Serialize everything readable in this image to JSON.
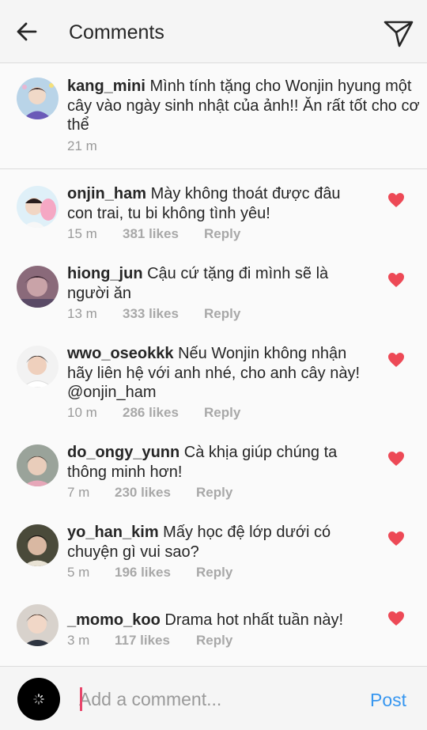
{
  "header": {
    "title": "Comments",
    "back_icon": "arrow-left-icon",
    "send_icon": "paper-plane-icon"
  },
  "caption": {
    "username": "kang_mini",
    "text": "Mình tính tặng cho Wonjin hyung một cây vào ngày sinh nhật của ảnh!! Ăn rất tốt cho cơ thể",
    "time": "21 m"
  },
  "comments": [
    {
      "username": "onjin_ham",
      "text": "Mày không thoát được đâu con trai, tu bi không tình yêu!",
      "time": "15 m",
      "likes": "381 likes",
      "reply": "Reply",
      "liked": true
    },
    {
      "username": "hiong_jun",
      "text": "Cậu cứ tặng đi mình sẽ là người ăn",
      "time": "13 m",
      "likes": "333 likes",
      "reply": "Reply",
      "liked": true
    },
    {
      "username": "wwo_oseokkk",
      "text": "Nếu Wonjin không nhận hãy liên hệ với anh nhé, cho anh cây này! @onjin_ham",
      "time": "10 m",
      "likes": "286 likes",
      "reply": "Reply",
      "liked": true
    },
    {
      "username": "do_ongy_yunn",
      "text": "Cà khịa giúp chúng ta thông minh hơn!",
      "time": "7 m",
      "likes": "230 likes",
      "reply": "Reply",
      "liked": true
    },
    {
      "username": "yo_han_kim",
      "text": "Mấy học đệ lớp dưới có chuyện gì vui sao?",
      "time": "5 m",
      "likes": "196 likes",
      "reply": "Reply",
      "liked": true
    },
    {
      "username": "_momo_koo",
      "text": "Drama hot nhất tuần này!",
      "time": "3 m",
      "likes": "117 likes",
      "reply": "Reply",
      "liked": true
    }
  ],
  "composer": {
    "placeholder": "Add a comment...",
    "post_label": "Post"
  },
  "colors": {
    "heart": "#ed4956",
    "post": "#3897f0",
    "cursor": "#e8456b"
  }
}
